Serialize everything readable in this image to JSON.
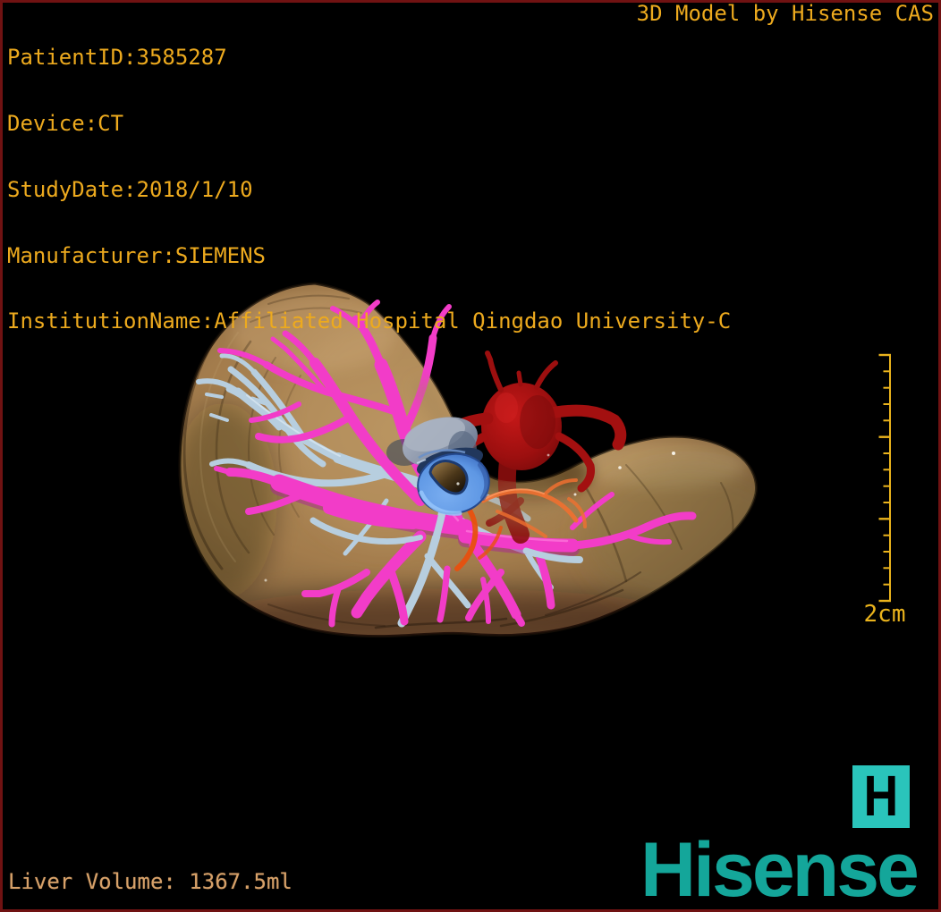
{
  "app": {
    "watermark": "3D Model by Hisense CAS"
  },
  "patient_info": {
    "patient_id": "PatientID:3585287",
    "device": "Device:CT",
    "study_date": "StudyDate:2018/1/10",
    "manufacturer": "Manufacturer:SIEMENS",
    "institution": "InstitutionName:Affiliated Hospital Qingdao University-C"
  },
  "measurements": {
    "liver_volume": "Liver Volume: 1367.5ml",
    "scale_label": "2cm"
  },
  "branding": {
    "logo_letter": "H",
    "wordmark": "Hisense"
  },
  "model": {
    "structures": [
      {
        "name": "liver-surface",
        "color": "#a8824f"
      },
      {
        "name": "portal-vein",
        "color": "#f23cc8"
      },
      {
        "name": "hepatic-vein",
        "color": "#b7cedf"
      },
      {
        "name": "hepatic-artery",
        "color": "#a81111"
      },
      {
        "name": "ivc-ring",
        "color": "#5e97e4"
      },
      {
        "name": "accessory-vessel",
        "color": "#f07030"
      }
    ]
  },
  "colors": {
    "overlay_text": "#edaa1e",
    "volume_text": "#d7a169",
    "ruler": "#eab31c",
    "logo_teal": "#2ac4bb",
    "wordmark_teal": "#14a69a",
    "frame_border": "#701212",
    "background": "#000000"
  }
}
